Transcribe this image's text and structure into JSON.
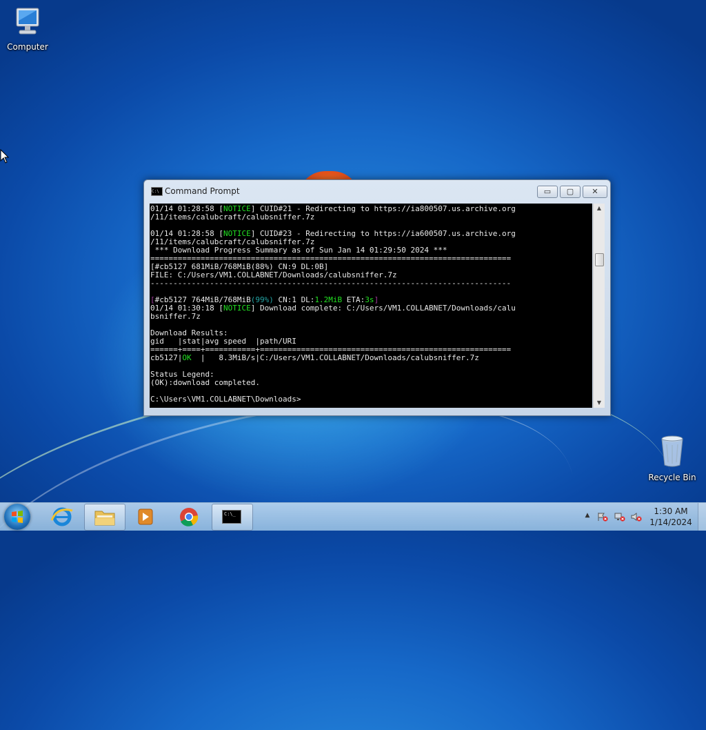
{
  "desktop": {
    "icons": [
      {
        "label": "Computer",
        "icon": "computer-icon"
      },
      {
        "label": "Recycle Bin",
        "icon": "recycle-bin-icon"
      }
    ]
  },
  "window": {
    "title": "Command Prompt",
    "buttons": {
      "minimize": "▭",
      "maximize": "▢",
      "close": "✕"
    }
  },
  "console": {
    "lines": [
      [
        {
          "t": "01/14 01:28:58 ["
        },
        {
          "t": "NOTICE",
          "c": "g"
        },
        {
          "t": "] CUID#21 - Redirecting to https://ia800507.us.archive.org"
        }
      ],
      [
        {
          "t": "/11/items/calubcraft/calubsniffer.7z"
        }
      ],
      [
        {
          "t": ""
        }
      ],
      [
        {
          "t": "01/14 01:28:58 ["
        },
        {
          "t": "NOTICE",
          "c": "g"
        },
        {
          "t": "] CUID#23 - Redirecting to https://ia600507.us.archive.org"
        }
      ],
      [
        {
          "t": "/11/items/calubcraft/calubsniffer.7z"
        }
      ],
      [
        {
          "t": " *** Download Progress Summary as of Sun Jan 14 01:29:50 2024 ***"
        }
      ],
      [
        {
          "t": "==============================================================================="
        }
      ],
      [
        {
          "t": "[#cb5127 681MiB/768MiB(88%) CN:9 DL:0B]"
        }
      ],
      [
        {
          "t": "FILE: C:/Users/VM1.COLLABNET/Downloads/calubsniffer.7z"
        }
      ],
      [
        {
          "t": "-------------------------------------------------------------------------------"
        }
      ],
      [
        {
          "t": ""
        }
      ],
      [
        {
          "t": "[",
          "c": "m"
        },
        {
          "t": "#cb5127 764MiB/768MiB"
        },
        {
          "t": "(99%)",
          "c": "c"
        },
        {
          "t": " CN:1 DL:"
        },
        {
          "t": "1.2MiB",
          "c": "g"
        },
        {
          "t": " ETA:"
        },
        {
          "t": "3s",
          "c": "g"
        },
        {
          "t": "]",
          "c": "m"
        }
      ],
      [
        {
          "t": "01/14 01:30:18 ["
        },
        {
          "t": "NOTICE",
          "c": "g"
        },
        {
          "t": "] Download complete: C:/Users/VM1.COLLABNET/Downloads/calu"
        }
      ],
      [
        {
          "t": "bsniffer.7z"
        }
      ],
      [
        {
          "t": ""
        }
      ],
      [
        {
          "t": "Download Results:"
        }
      ],
      [
        {
          "t": "gid   |stat|avg speed  |path/URI"
        }
      ],
      [
        {
          "t": "======+====+===========+======================================================="
        }
      ],
      [
        {
          "t": "cb5127|"
        },
        {
          "t": "OK",
          "c": "g"
        },
        {
          "t": "  |   8.3MiB/s|C:/Users/VM1.COLLABNET/Downloads/calubsniffer.7z"
        }
      ],
      [
        {
          "t": ""
        }
      ],
      [
        {
          "t": "Status Legend:"
        }
      ],
      [
        {
          "t": "(OK):download completed."
        }
      ],
      [
        {
          "t": ""
        }
      ],
      [
        {
          "t": "C:\\Users\\VM1.COLLABNET\\Downloads>"
        }
      ]
    ]
  },
  "taskbar": {
    "apps": [
      {
        "name": "internet-explorer",
        "icon": "internet-explorer-icon"
      },
      {
        "name": "file-explorer",
        "icon": "folder-icon"
      },
      {
        "name": "media-player",
        "icon": "media-player-icon"
      },
      {
        "name": "chrome",
        "icon": "chrome-icon"
      },
      {
        "name": "command-prompt",
        "icon": "command-prompt-icon",
        "glyph": "C:\\_"
      }
    ],
    "tray": {
      "arrow": "▲",
      "time": "1:30 AM",
      "date": "1/14/2024"
    }
  }
}
